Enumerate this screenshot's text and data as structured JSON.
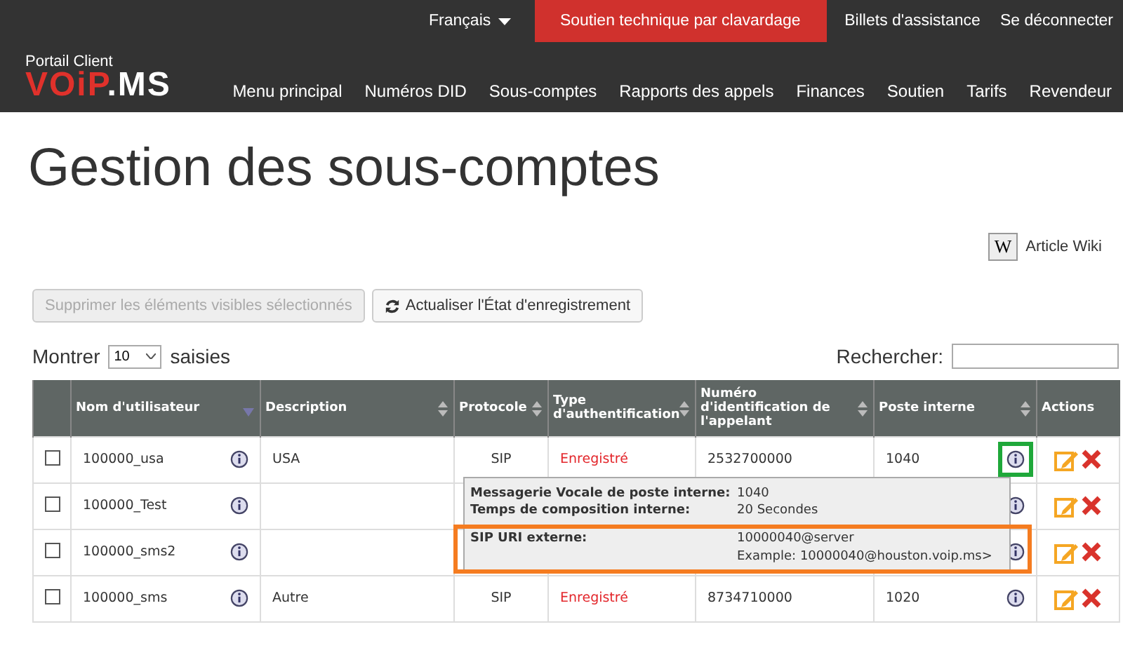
{
  "top_bar": {
    "language": "Français",
    "chat_button": "Soutien technique par clavardage",
    "links": [
      "Billets d'assistance",
      "Se déconnecter"
    ]
  },
  "brand": {
    "portal_label": "Portail Client",
    "logo_parts": [
      {
        "text": "VOiP",
        "color": "#e0312b"
      },
      {
        "text": ".MS",
        "color": "#ffffff"
      }
    ]
  },
  "nav": [
    "Menu principal",
    "Numéros DID",
    "Sous-comptes",
    "Rapports des appels",
    "Finances",
    "Soutien",
    "Tarifs",
    "Revendeur"
  ],
  "page_title": "Gestion des sous-comptes",
  "wiki_link": {
    "icon_letter": "W",
    "label": "Article Wiki"
  },
  "buttons": [
    {
      "label": "Supprimer les éléments visibles sélectionnés",
      "disabled": true,
      "kind": "plain"
    },
    {
      "label": "Actualiser l'État d'enregistrement",
      "disabled": false,
      "kind": "refresh"
    }
  ],
  "length_menu": {
    "before": "Montrer",
    "value": "10",
    "after": "saisies"
  },
  "search": {
    "label": "Rechercher:"
  },
  "table": {
    "columns": [
      {},
      {
        "label": "Nom d'utilisateur",
        "sorted": true
      },
      {
        "label": "Description",
        "sorted": false
      },
      {
        "label": "Protocole",
        "sorted": false
      },
      {
        "label": "Type d'authentification",
        "sorted": false
      },
      {
        "label": "Numéro d'identification de l'appelant",
        "sorted": false
      },
      {
        "label": "Poste interne",
        "sorted": false
      },
      {
        "label": "Actions"
      }
    ],
    "rows": [
      {
        "checked": false,
        "username": "100000_usa",
        "description": "USA",
        "protocol": "SIP",
        "auth": "Enregistré",
        "caller_id": "2532700000",
        "extension": "1040",
        "color": "#1fa83a"
      },
      {
        "checked": false,
        "username": "100000_Test",
        "description": "",
        "protocol": "",
        "auth": "",
        "caller_id": "",
        "extension": ""
      },
      {
        "checked": false,
        "username": "100000_sms2",
        "description": "",
        "protocol": "",
        "auth": "",
        "caller_id": "",
        "extension": ""
      },
      {
        "checked": false,
        "username": "100000_sms",
        "description": "Autre",
        "protocol": "SIP",
        "auth": "Enregistré",
        "caller_id": "8734710000",
        "extension": "1020"
      }
    ]
  },
  "tooltip": {
    "lines": [
      {
        "label": "Messagerie Vocale de poste interne:",
        "value": "1040"
      },
      {
        "label": "Temps de composition interne:",
        "value": "20 Secondes"
      },
      {
        "label": "SIP URI externe:",
        "value": "10000040@server",
        "value_2": "Example: 10000040@houston.voip.ms>",
        "color": "#f57c20"
      }
    ]
  }
}
